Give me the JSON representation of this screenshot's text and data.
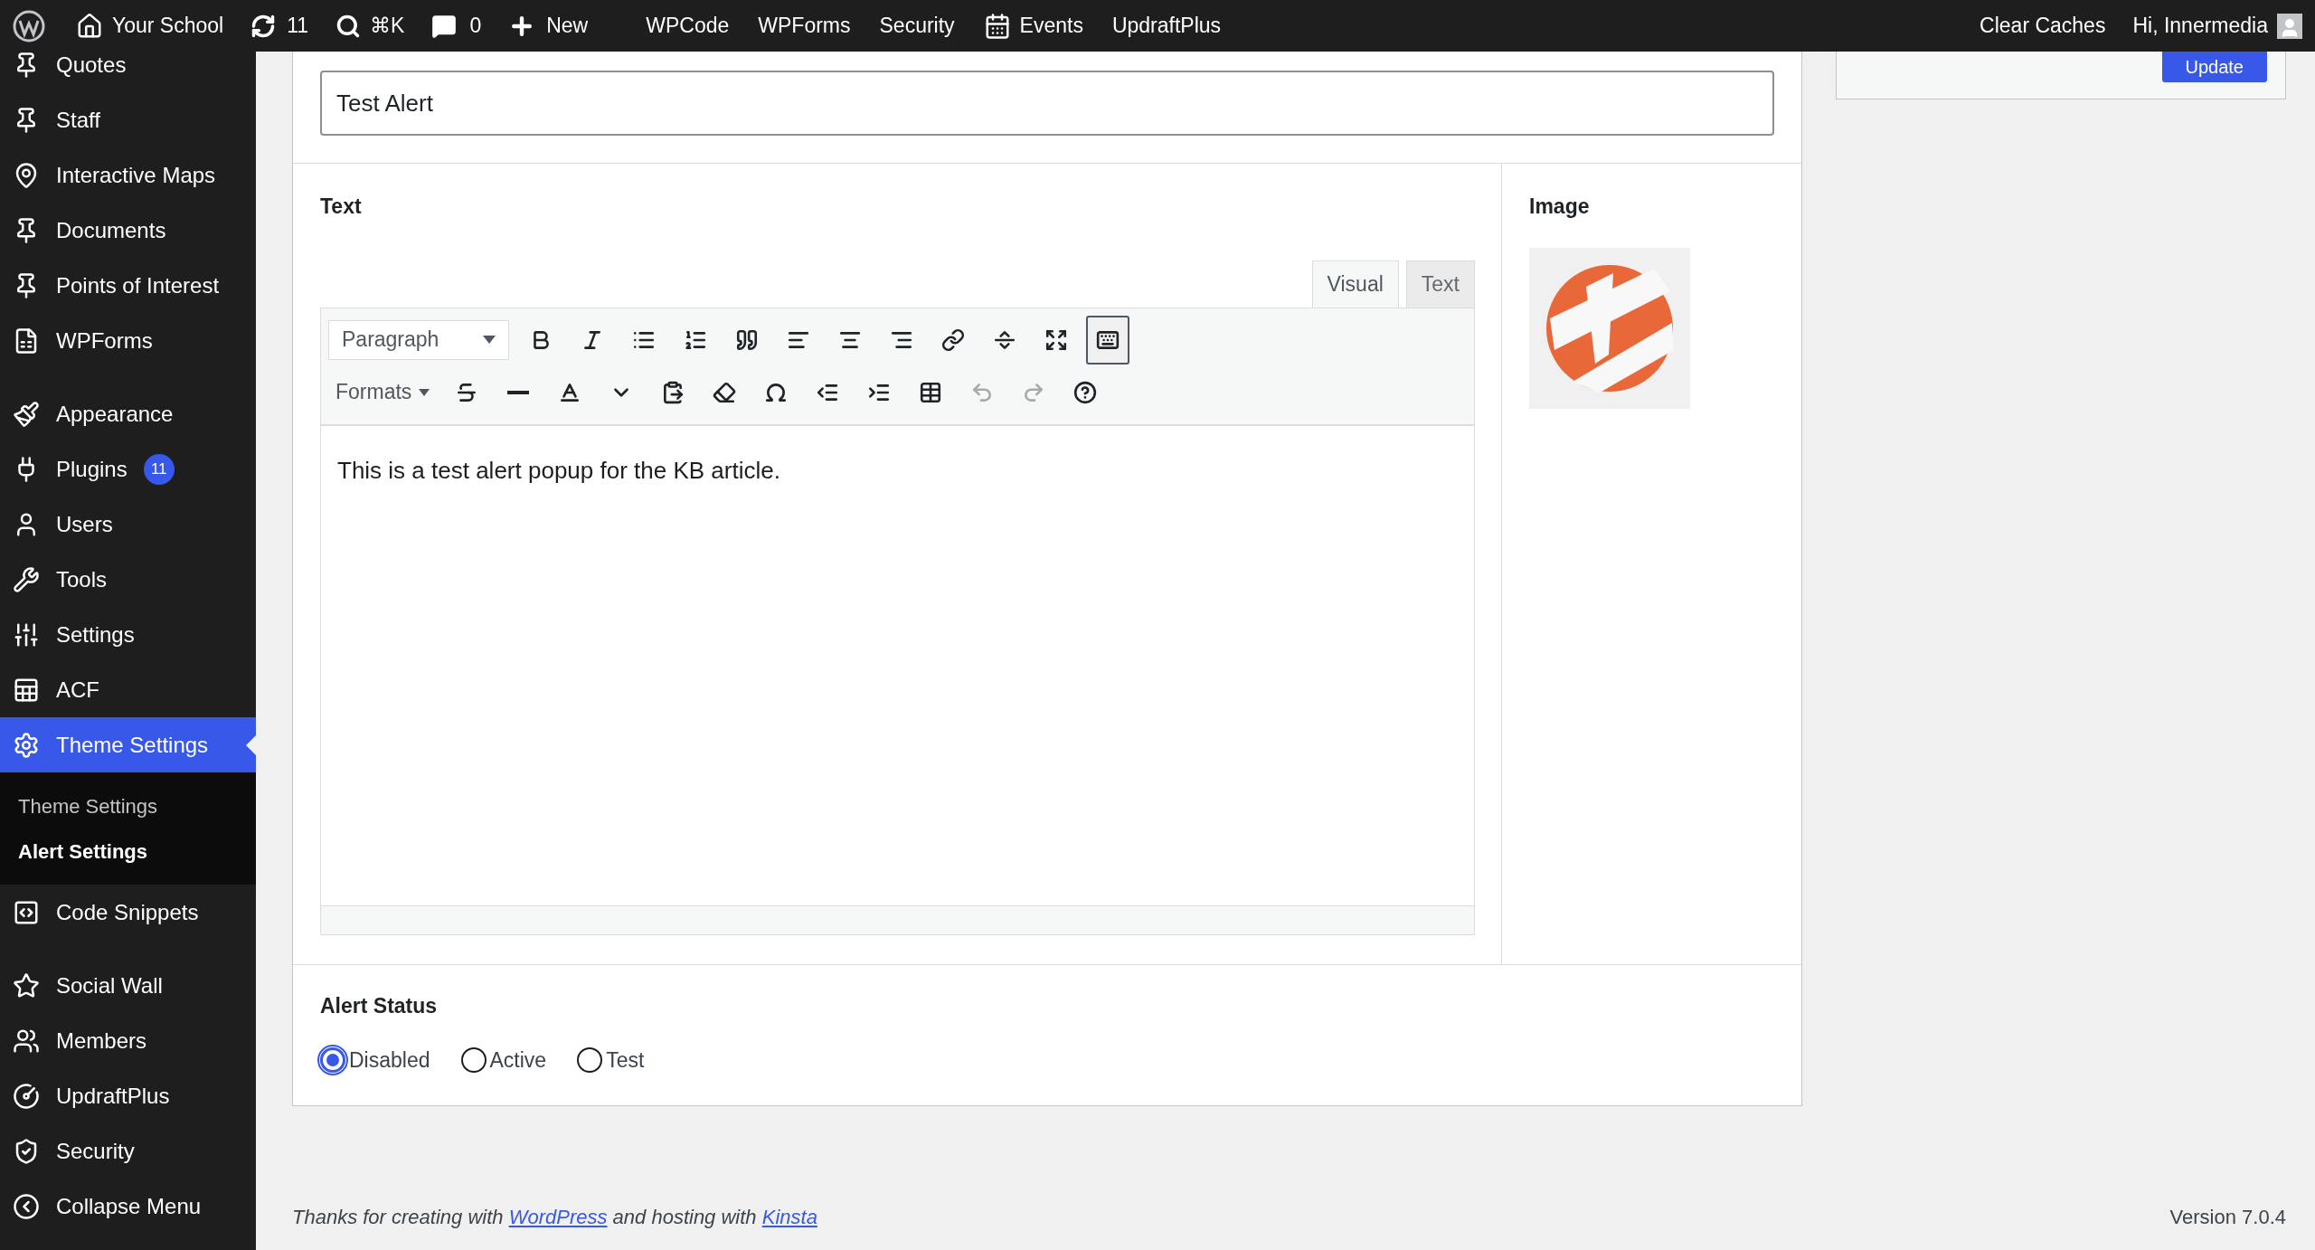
{
  "admin_bar": {
    "site": "Your School",
    "updates": "11",
    "search_shortcut": "⌘K",
    "comments": "0",
    "new": "New",
    "plugin_links": [
      "WPCode",
      "WPForms",
      "Security",
      "Events",
      "UpdraftPlus"
    ],
    "clear_caches": "Clear Caches",
    "greeting": "Hi, Innermedia"
  },
  "sidebar": {
    "groups": [
      [
        {
          "label": "Quotes",
          "selected": false
        },
        {
          "label": "Staff",
          "selected": false
        },
        {
          "label": "Interactive Maps",
          "selected": false
        },
        {
          "label": "Documents",
          "selected": false
        },
        {
          "label": "Points of Interest",
          "selected": false
        },
        {
          "label": "WPForms",
          "selected": false
        }
      ],
      [
        {
          "label": "Appearance",
          "selected": false
        },
        {
          "label": "Plugins",
          "selected": false,
          "badge": "11"
        },
        {
          "label": "Users",
          "selected": false
        },
        {
          "label": "Tools",
          "selected": false
        },
        {
          "label": "Settings",
          "selected": false
        },
        {
          "label": "ACF",
          "selected": false
        },
        {
          "label": "Theme Settings",
          "selected": true,
          "children": [
            {
              "label": "Theme Settings",
              "selected": false
            },
            {
              "label": "Alert Settings",
              "selected": true
            }
          ]
        },
        {
          "label": "Code Snippets",
          "selected": false
        }
      ],
      [
        {
          "label": "Social Wall",
          "selected": false
        },
        {
          "label": "Members",
          "selected": false
        },
        {
          "label": "UpdraftPlus",
          "selected": false
        },
        {
          "label": "Security",
          "selected": false
        },
        {
          "label": "Collapse Menu",
          "selected": false
        }
      ]
    ]
  },
  "title_field": {
    "value": "Test Alert"
  },
  "text_field": {
    "label": "Text",
    "tabs": [
      {
        "label": "Visual",
        "selected": true
      },
      {
        "label": "Text",
        "selected": false
      }
    ],
    "block_format": "Paragraph",
    "formats": "Formats",
    "toolbar_toggle_pressed": true,
    "undo_disabled": true,
    "redo_disabled": true,
    "content": "This is a test alert popup for the KB article."
  },
  "image_field": {
    "label": "Image"
  },
  "alert_status": {
    "label": "Alert Status",
    "options": [
      {
        "label": "Disabled",
        "selected": true
      },
      {
        "label": "Active",
        "selected": false
      },
      {
        "label": "Test",
        "selected": false
      }
    ]
  },
  "publish_box": {
    "button": "Update"
  },
  "footer": {
    "credit": [
      {
        "kind": "text",
        "text": "Thanks for creating with"
      },
      {
        "kind": "link",
        "text": "WordPress"
      },
      {
        "kind": "text",
        "text": "and hosting with"
      },
      {
        "kind": "link",
        "text": "Kinsta"
      }
    ],
    "version": "Version 7.0.4"
  }
}
